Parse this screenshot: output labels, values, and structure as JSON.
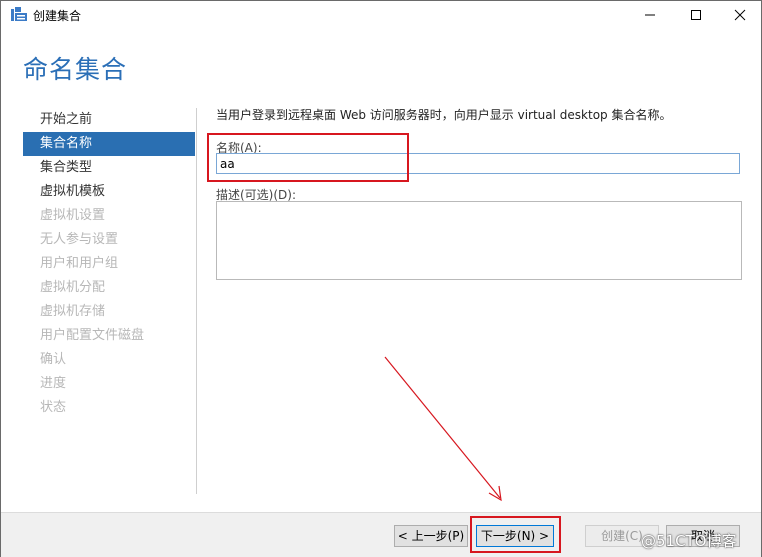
{
  "window": {
    "title": "创建集合"
  },
  "page": {
    "title": "命名集合"
  },
  "nav": {
    "items": [
      {
        "label": "开始之前",
        "state": "normal"
      },
      {
        "label": "集合名称",
        "state": "active"
      },
      {
        "label": "集合类型",
        "state": "normal"
      },
      {
        "label": "虚拟机模板",
        "state": "normal"
      },
      {
        "label": "虚拟机设置",
        "state": "disabled"
      },
      {
        "label": "无人参与设置",
        "state": "disabled"
      },
      {
        "label": "用户和用户组",
        "state": "disabled"
      },
      {
        "label": "虚拟机分配",
        "state": "disabled"
      },
      {
        "label": "虚拟机存储",
        "state": "disabled"
      },
      {
        "label": "用户配置文件磁盘",
        "state": "disabled"
      },
      {
        "label": "确认",
        "state": "disabled"
      },
      {
        "label": "进度",
        "state": "disabled"
      },
      {
        "label": "状态",
        "state": "disabled"
      }
    ]
  },
  "content": {
    "description": "当用户登录到远程桌面 Web 访问服务器时，向用户显示 virtual desktop 集合名称。",
    "name_label": "名称(A):",
    "name_value": "aa",
    "desc_label": "描述(可选)(D):",
    "desc_value": ""
  },
  "footer": {
    "prev_label": "< 上一步(P)",
    "next_label": "下一步(N) >",
    "create_label": "创建(C)",
    "cancel_label": "取消"
  },
  "watermark": "@51CTO博客",
  "colors": {
    "accent": "#2a6fb2",
    "title": "#2b6fb7",
    "highlight": "#d7171f"
  }
}
